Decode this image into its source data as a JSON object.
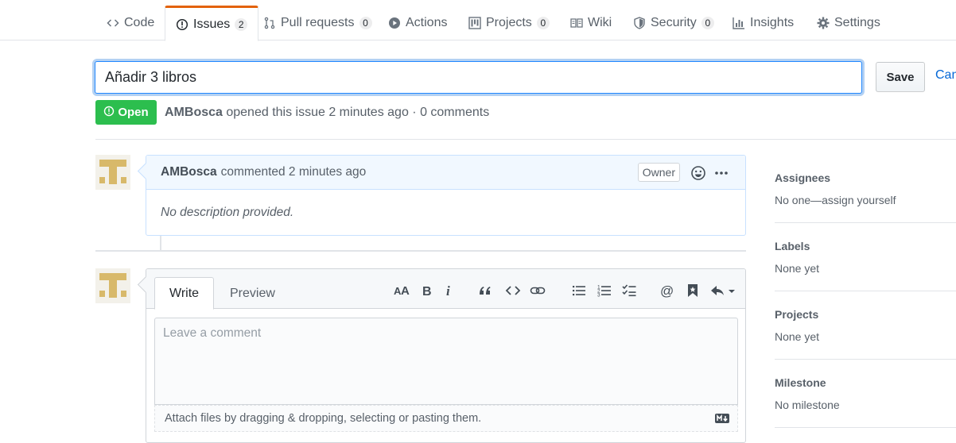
{
  "repo_nav": {
    "tabs": [
      {
        "label": "Code",
        "icon": "code-icon"
      },
      {
        "label": "Issues",
        "icon": "issue-opened-icon",
        "count": "2",
        "selected": true
      },
      {
        "label": "Pull requests",
        "icon": "git-pull-request-icon",
        "count": "0"
      },
      {
        "label": "Actions",
        "icon": "play-icon"
      },
      {
        "label": "Projects",
        "icon": "project-icon",
        "count": "0"
      },
      {
        "label": "Wiki",
        "icon": "book-icon"
      },
      {
        "label": "Security",
        "icon": "shield-icon",
        "count": "0"
      },
      {
        "label": "Insights",
        "icon": "graph-icon"
      },
      {
        "label": "Settings",
        "icon": "gear-icon"
      }
    ]
  },
  "issue": {
    "title_value": "Añadir 3 libros",
    "save_label": "Save",
    "cancel_label": "Cancel",
    "state": "Open",
    "author": "AMBosca",
    "meta_text": "opened this issue 2 minutes ago · 0 comments"
  },
  "comment": {
    "author": "AMBosca",
    "action": "commented 2 minutes ago",
    "role_label": "Owner",
    "body": "No description provided."
  },
  "editor": {
    "tab_write": "Write",
    "tab_preview": "Preview",
    "placeholder": "Leave a comment",
    "attach_text": "Attach files by dragging & dropping, selecting or pasting them.",
    "toolbar_icons": [
      "text-size-icon",
      "bold-icon",
      "italic-icon",
      "quote-icon",
      "code-icon",
      "link-icon",
      "unordered-list-icon",
      "ordered-list-icon",
      "tasklist-icon",
      "mention-icon",
      "saved-reply-icon",
      "reply-icon"
    ]
  },
  "sidebar": {
    "assignees": {
      "title": "Assignees",
      "value": "No one—assign yourself"
    },
    "labels": {
      "title": "Labels",
      "value": "None yet"
    },
    "projects": {
      "title": "Projects",
      "value": "None yet"
    },
    "milestone": {
      "title": "Milestone",
      "value": "No milestone"
    }
  },
  "colors": {
    "accent": "#e36209",
    "open_green": "#2cbe4e",
    "link_blue": "#0366d6",
    "comment_header_bg": "#f1f8ff"
  }
}
